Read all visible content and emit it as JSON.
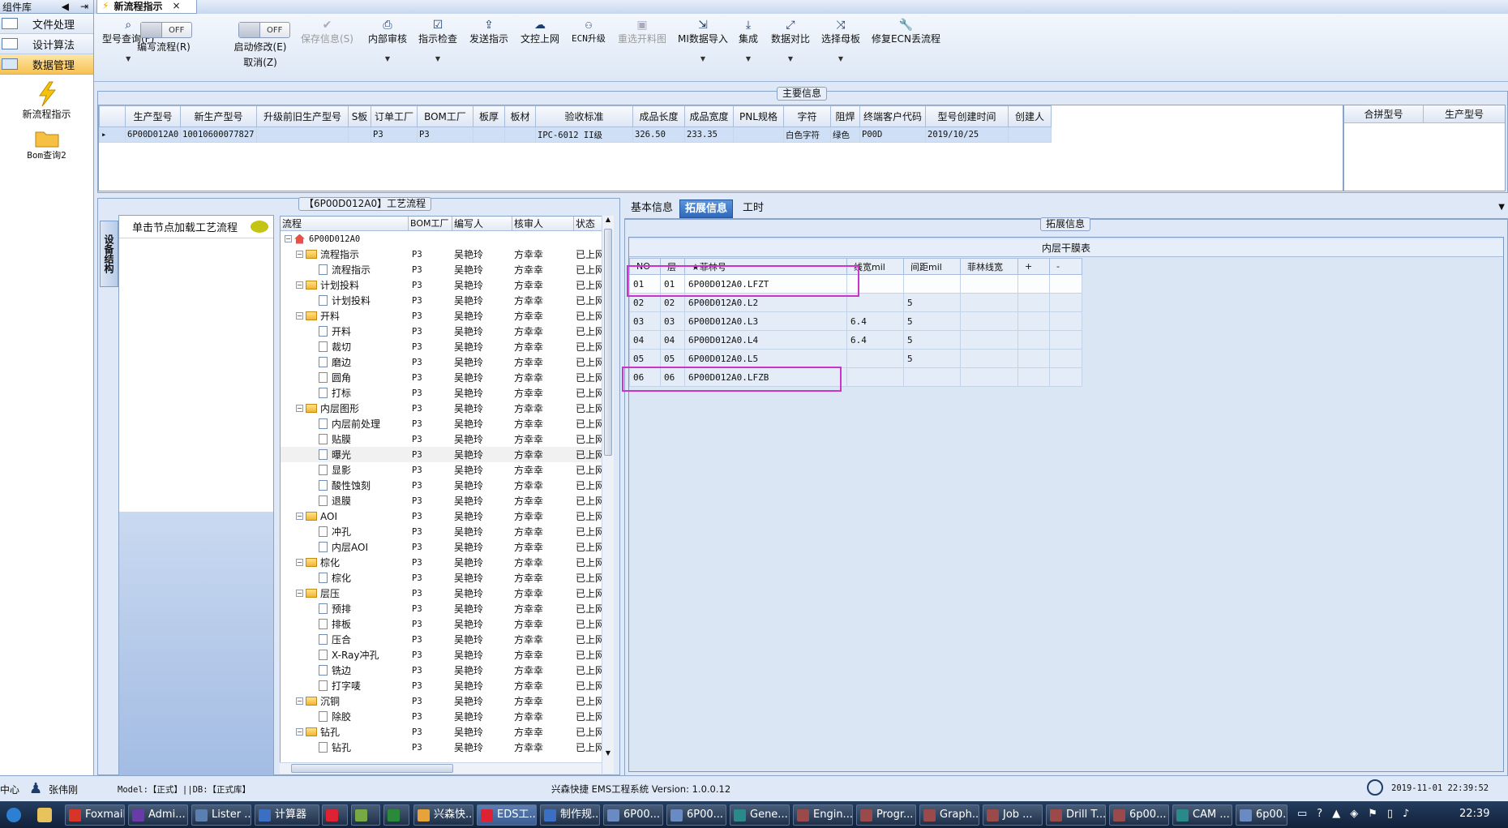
{
  "nav": {
    "header": "组件库",
    "items": [
      {
        "label": "文件处理"
      },
      {
        "label": "设计算法"
      },
      {
        "label": "数据管理",
        "active": true
      }
    ],
    "launchers": [
      {
        "label": "新流程指示"
      },
      {
        "label": "Bom查询2"
      }
    ]
  },
  "doc_tab": "新流程指示",
  "toolbar": {
    "query": "型号查询(F)",
    "edit_flow": "编写流程(R)",
    "start_edit": "启动修改(E)",
    "cancel": "取消(Z)",
    "save": "保存信息(S)",
    "internal_review": "内部审核",
    "check": "指示检查",
    "send": "发送指示",
    "upload": "文控上网",
    "ecn": "ECN升级",
    "reselect": "重选开料图",
    "mi_import": "MI数据导入",
    "integrate": "集成",
    "compare": "数据对比",
    "template": "选择母板",
    "repair": "修复ECN丢流程",
    "toggle_off": "OFF"
  },
  "main_info": {
    "label": "主要信息",
    "columns": [
      "生产型号",
      "新生产型号",
      "升级前旧生产型号",
      "S板",
      "订单工厂",
      "BOM工厂",
      "板厚",
      "板材",
      "验收标准",
      "成品长度",
      "成品宽度",
      "PNL规格",
      "字符",
      "阻焊",
      "终端客户代码",
      "型号创建时间",
      "创建人"
    ],
    "row": [
      "6P00D012A0",
      "10010600077827",
      "",
      "",
      "P3",
      "P3",
      "",
      "",
      "IPC-6012 II级",
      "326.50",
      "233.35",
      "",
      "白色字符",
      "绿色",
      "P00D",
      "2019/10/25",
      ""
    ],
    "side_columns": [
      "合拼型号",
      "生产型号"
    ]
  },
  "process": {
    "label": "【6P00D012A0】工艺流程",
    "vertical_tab": "设备结构",
    "load_hint": "单击节点加载工艺流程",
    "columns": [
      "流程",
      "BOM工厂",
      "编写人",
      "核审人",
      "状态"
    ],
    "root": "6P00D012A0",
    "rows": [
      {
        "name": "流程指示",
        "type": "folder",
        "bom": "P3",
        "writer": "吴艳玲",
        "reviewer": "方幸幸",
        "status": "已上网"
      },
      {
        "name": "流程指示",
        "type": "doc",
        "bom": "P3",
        "writer": "吴艳玲",
        "reviewer": "方幸幸",
        "status": "已上网"
      },
      {
        "name": "计划投料",
        "type": "folder",
        "bom": "P3",
        "writer": "吴艳玲",
        "reviewer": "方幸幸",
        "status": "已上网"
      },
      {
        "name": "计划投料",
        "type": "doc",
        "bom": "P3",
        "writer": "吴艳玲",
        "reviewer": "方幸幸",
        "status": "已上网"
      },
      {
        "name": "开料",
        "type": "folder",
        "bom": "P3",
        "writer": "吴艳玲",
        "reviewer": "方幸幸",
        "status": "已上网"
      },
      {
        "name": "开料",
        "type": "doc",
        "bom": "P3",
        "writer": "吴艳玲",
        "reviewer": "方幸幸",
        "status": "已上网"
      },
      {
        "name": "裁切",
        "type": "doc",
        "bom": "P3",
        "writer": "吴艳玲",
        "reviewer": "方幸幸",
        "status": "已上网"
      },
      {
        "name": "磨边",
        "type": "doc",
        "bom": "P3",
        "writer": "吴艳玲",
        "reviewer": "方幸幸",
        "status": "已上网"
      },
      {
        "name": "圆角",
        "type": "doc",
        "bom": "P3",
        "writer": "吴艳玲",
        "reviewer": "方幸幸",
        "status": "已上网"
      },
      {
        "name": "打标",
        "type": "doc",
        "bom": "P3",
        "writer": "吴艳玲",
        "reviewer": "方幸幸",
        "status": "已上网"
      },
      {
        "name": "内层图形",
        "type": "folder",
        "bom": "P3",
        "writer": "吴艳玲",
        "reviewer": "方幸幸",
        "status": "已上网"
      },
      {
        "name": "内层前处理",
        "type": "doc",
        "bom": "P3",
        "writer": "吴艳玲",
        "reviewer": "方幸幸",
        "status": "已上网"
      },
      {
        "name": "贴膜",
        "type": "doc",
        "bom": "P3",
        "writer": "吴艳玲",
        "reviewer": "方幸幸",
        "status": "已上网"
      },
      {
        "name": "曝光",
        "type": "doc",
        "bom": "P3",
        "writer": "吴艳玲",
        "reviewer": "方幸幸",
        "status": "已上网",
        "hl": true
      },
      {
        "name": "显影",
        "type": "doc",
        "bom": "P3",
        "writer": "吴艳玲",
        "reviewer": "方幸幸",
        "status": "已上网"
      },
      {
        "name": "酸性蚀刻",
        "type": "doc",
        "bom": "P3",
        "writer": "吴艳玲",
        "reviewer": "方幸幸",
        "status": "已上网"
      },
      {
        "name": "退膜",
        "type": "doc",
        "bom": "P3",
        "writer": "吴艳玲",
        "reviewer": "方幸幸",
        "status": "已上网"
      },
      {
        "name": "AOI",
        "type": "folder",
        "bom": "P3",
        "writer": "吴艳玲",
        "reviewer": "方幸幸",
        "status": "已上网"
      },
      {
        "name": "冲孔",
        "type": "doc",
        "bom": "P3",
        "writer": "吴艳玲",
        "reviewer": "方幸幸",
        "status": "已上网"
      },
      {
        "name": "内层AOI",
        "type": "doc",
        "bom": "P3",
        "writer": "吴艳玲",
        "reviewer": "方幸幸",
        "status": "已上网"
      },
      {
        "name": "棕化",
        "type": "folder",
        "bom": "P3",
        "writer": "吴艳玲",
        "reviewer": "方幸幸",
        "status": "已上网"
      },
      {
        "name": "棕化",
        "type": "doc",
        "bom": "P3",
        "writer": "吴艳玲",
        "reviewer": "方幸幸",
        "status": "已上网"
      },
      {
        "name": "层压",
        "type": "folder",
        "bom": "P3",
        "writer": "吴艳玲",
        "reviewer": "方幸幸",
        "status": "已上网"
      },
      {
        "name": "预排",
        "type": "doc",
        "bom": "P3",
        "writer": "吴艳玲",
        "reviewer": "方幸幸",
        "status": "已上网"
      },
      {
        "name": "排板",
        "type": "doc",
        "bom": "P3",
        "writer": "吴艳玲",
        "reviewer": "方幸幸",
        "status": "已上网"
      },
      {
        "name": "压合",
        "type": "doc",
        "bom": "P3",
        "writer": "吴艳玲",
        "reviewer": "方幸幸",
        "status": "已上网"
      },
      {
        "name": "X-Ray冲孔",
        "type": "doc",
        "bom": "P3",
        "writer": "吴艳玲",
        "reviewer": "方幸幸",
        "status": "已上网"
      },
      {
        "name": "铣边",
        "type": "doc",
        "bom": "P3",
        "writer": "吴艳玲",
        "reviewer": "方幸幸",
        "status": "已上网"
      },
      {
        "name": "打字唛",
        "type": "doc",
        "bom": "P3",
        "writer": "吴艳玲",
        "reviewer": "方幸幸",
        "status": "已上网"
      },
      {
        "name": "沉铜",
        "type": "folder",
        "bom": "P3",
        "writer": "吴艳玲",
        "reviewer": "方幸幸",
        "status": "已上网"
      },
      {
        "name": "除胶",
        "type": "doc",
        "bom": "P3",
        "writer": "吴艳玲",
        "reviewer": "方幸幸",
        "status": "已上网"
      },
      {
        "name": "钻孔",
        "type": "folder",
        "bom": "P3",
        "writer": "吴艳玲",
        "reviewer": "方幸幸",
        "status": "已上网"
      },
      {
        "name": "钻孔",
        "type": "doc",
        "bom": "P3",
        "writer": "吴艳玲",
        "reviewer": "方幸幸",
        "status": "已上网"
      }
    ]
  },
  "right": {
    "tabs": [
      {
        "label": "基本信息"
      },
      {
        "label": "拓展信息",
        "active": true
      },
      {
        "label": "工时"
      }
    ],
    "group_label": "拓展信息",
    "caption": "内层干膜表",
    "columns": [
      "NO",
      "层",
      "★菲林号",
      "线宽mil",
      "间距mil",
      "菲林线宽",
      "+",
      "-"
    ],
    "rows": [
      [
        "01",
        "01",
        "6P00D012A0.LFZT",
        "",
        "",
        "",
        "",
        ""
      ],
      [
        "02",
        "02",
        "6P00D012A0.L2",
        "",
        "5",
        "",
        "",
        ""
      ],
      [
        "03",
        "03",
        "6P00D012A0.L3",
        "6.4",
        "5",
        "",
        "",
        ""
      ],
      [
        "04",
        "04",
        "6P00D012A0.L4",
        "6.4",
        "5",
        "",
        "",
        ""
      ],
      [
        "05",
        "05",
        "6P00D012A0.L5",
        "",
        "5",
        "",
        "",
        ""
      ],
      [
        "06",
        "06",
        "6P00D012A0.LFZB",
        "",
        "",
        "",
        "",
        ""
      ]
    ]
  },
  "status": {
    "center": "中心",
    "user": "张伟刚",
    "model": "Model:【正式】||DB:【正式库】",
    "system": "兴森快捷 EMS工程系统 Version: 1.0.0.12",
    "datetime": "2019-11-01 22:39:52"
  },
  "taskbar": {
    "items": [
      "Foxmail",
      "Admi...",
      "Lister ...",
      "计算器",
      "",
      "",
      "",
      "兴森快...",
      "EDS工...",
      "制作规...",
      "6P00...",
      "6P00...",
      "Gene...",
      "Engin...",
      "Progr...",
      "Graph...",
      "Job ...",
      "Drill T...",
      "6p00...",
      "CAM ...",
      "6p00..."
    ],
    "clock": "22:39"
  },
  "colors": {
    "accent": "#2f68b8",
    "highlight": "#f3bf4f",
    "marker": "#cc33cc"
  }
}
